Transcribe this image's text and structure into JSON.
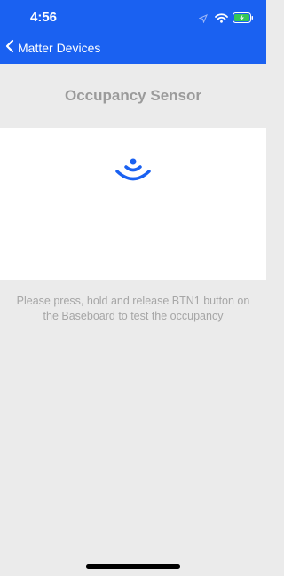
{
  "status_bar": {
    "time": "4:56",
    "icons": [
      "location-arrow-icon",
      "wifi-icon",
      "battery-charging-icon"
    ]
  },
  "nav": {
    "back_label": "Matter Devices",
    "back_icon": "chevron-left-icon"
  },
  "page": {
    "title": "Occupancy Sensor",
    "sensor_icon": "occupancy-signal-icon",
    "instructions_line1": "Please press, hold and release BTN1 button on",
    "instructions_line2": "the Baseboard to test the occupancy"
  },
  "colors": {
    "accent": "#1a61f1",
    "icon_blue": "#1a61f1",
    "background": "#ebebeb",
    "title_gray": "#9b9b9b",
    "battery_green": "#34c759"
  }
}
